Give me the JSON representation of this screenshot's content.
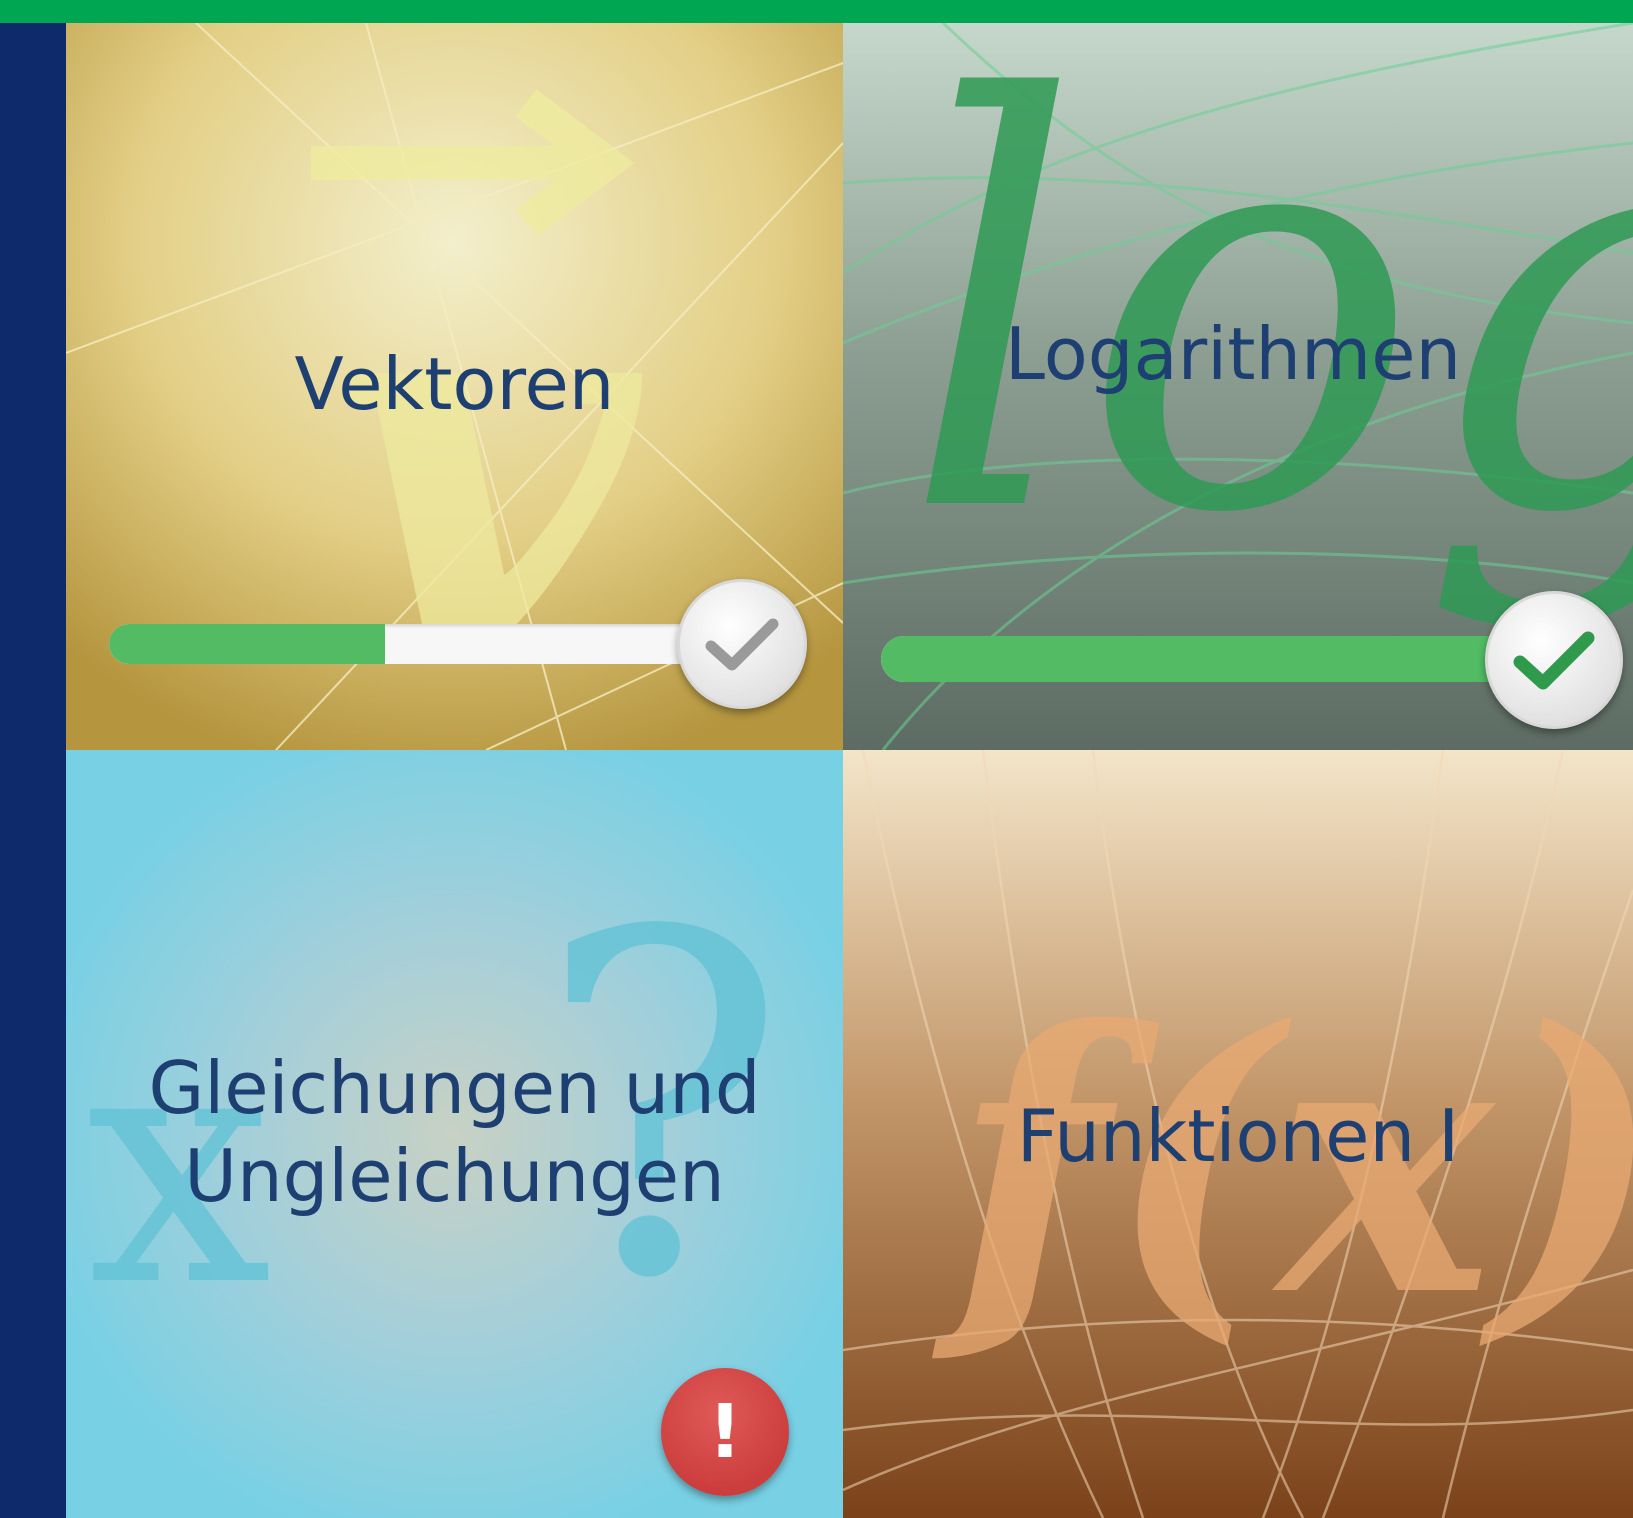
{
  "colors": {
    "topbar": "#00a651",
    "sidebar": "#0e2a6b",
    "title_text": "#1e3f72",
    "progress_fill": "#52bb64",
    "progress_track": "#f7f7f7",
    "check_gray": "#9a9a9a",
    "check_green": "#2f9a4c",
    "alert_red": "#d04545"
  },
  "tiles": [
    {
      "title": "Vektoren",
      "symbol": "v",
      "progress": 0.46,
      "status_icon": "check-gray-icon"
    },
    {
      "title": "Logarithmen",
      "symbol": "log",
      "progress": 1.0,
      "status_icon": "check-green-icon"
    },
    {
      "title_lines": [
        "Gleichungen und",
        "Ungleichungen"
      ],
      "symbol_left": "x",
      "symbol_right": "?",
      "status_icon": "alert-icon",
      "status_mark": "!"
    },
    {
      "title": "Funktionen I",
      "symbol": "f(x)"
    }
  ]
}
